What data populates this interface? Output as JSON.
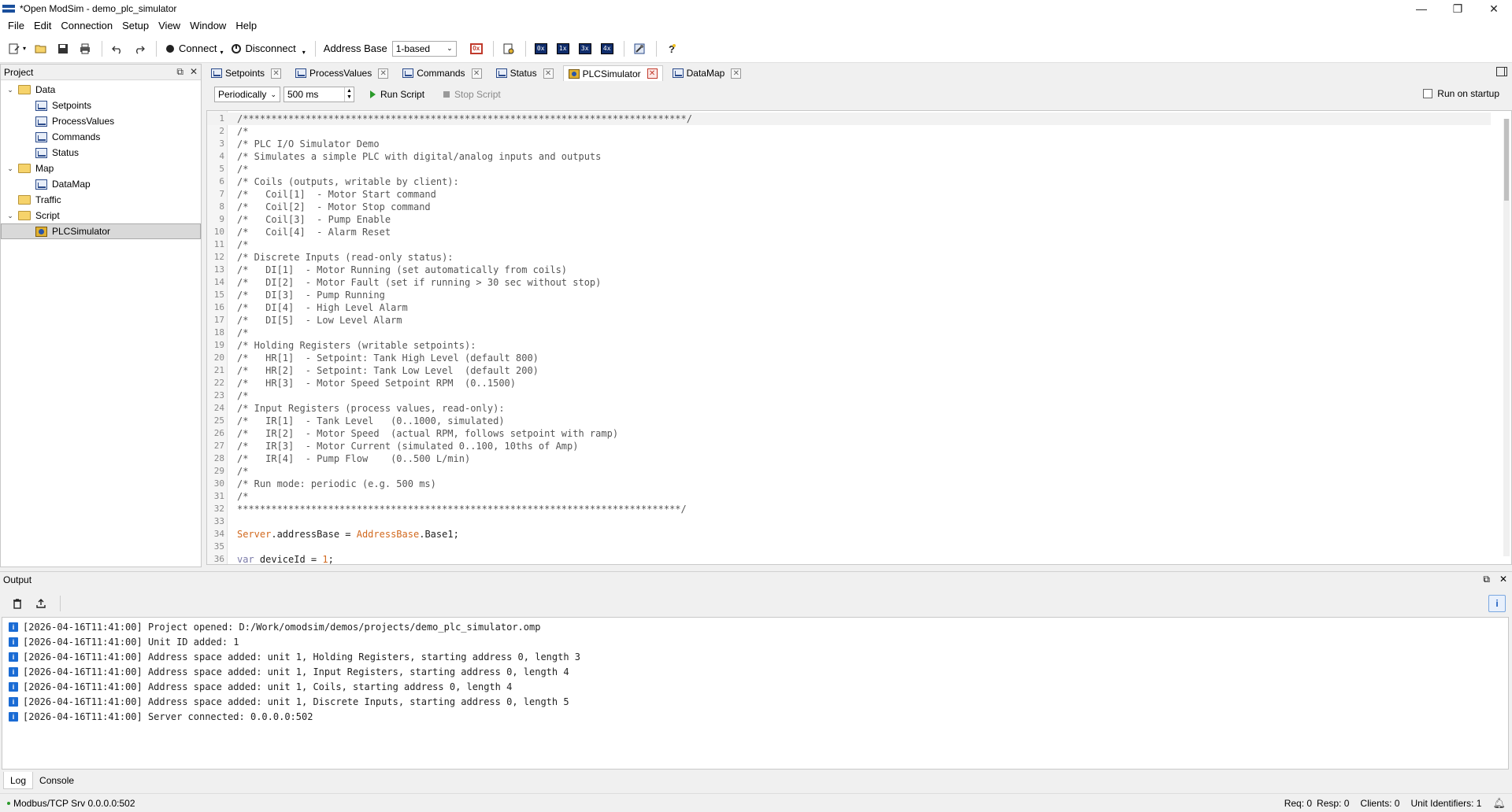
{
  "window": {
    "title": "*Open ModSim - demo_plc_simulator",
    "controls": [
      "—",
      "❐",
      "✕"
    ]
  },
  "menu": [
    "File",
    "Edit",
    "Connection",
    "Setup",
    "View",
    "Window",
    "Help"
  ],
  "toolbar": {
    "connect_label": "Connect",
    "disconnect_label": "Disconnect",
    "address_base_label": "Address Base",
    "address_base_value": "1-based",
    "reg_buttons": [
      "0x",
      "1x",
      "3x",
      "4x"
    ]
  },
  "project": {
    "title": "Project",
    "tree": [
      {
        "label": "Data",
        "type": "folder",
        "expanded": true,
        "children": [
          "Setpoints",
          "ProcessValues",
          "Commands",
          "Status"
        ]
      },
      {
        "label": "Map",
        "type": "folder",
        "expanded": true,
        "children": [
          "DataMap"
        ]
      },
      {
        "label": "Traffic",
        "type": "folder",
        "expanded": false,
        "children": []
      },
      {
        "label": "Script",
        "type": "folder",
        "expanded": true,
        "children": [
          "PLCSimulator"
        ]
      }
    ],
    "selected": "PLCSimulator"
  },
  "tabs": [
    {
      "label": "Setpoints",
      "kind": "data"
    },
    {
      "label": "ProcessValues",
      "kind": "data"
    },
    {
      "label": "Commands",
      "kind": "data"
    },
    {
      "label": "Status",
      "kind": "data"
    },
    {
      "label": "PLCSimulator",
      "kind": "script",
      "active": true
    },
    {
      "label": "DataMap",
      "kind": "data"
    }
  ],
  "script_toolbar": {
    "mode": "Periodically",
    "interval": "500 ms",
    "run_label": "Run Script",
    "stop_label": "Stop Script",
    "run_on_startup_label": "Run on startup",
    "run_on_startup_checked": false
  },
  "code_lines": [
    "/******************************************************************************/",
    "/*",
    "/* PLC I/O Simulator Demo",
    "/* Simulates a simple PLC with digital/analog inputs and outputs",
    "/*",
    "/* Coils (outputs, writable by client):",
    "/*   Coil[1]  - Motor Start command",
    "/*   Coil[2]  - Motor Stop command",
    "/*   Coil[3]  - Pump Enable",
    "/*   Coil[4]  - Alarm Reset",
    "/*",
    "/* Discrete Inputs (read-only status):",
    "/*   DI[1]  - Motor Running (set automatically from coils)",
    "/*   DI[2]  - Motor Fault (set if running > 30 sec without stop)",
    "/*   DI[3]  - Pump Running",
    "/*   DI[4]  - High Level Alarm",
    "/*   DI[5]  - Low Level Alarm",
    "/*",
    "/* Holding Registers (writable setpoints):",
    "/*   HR[1]  - Setpoint: Tank High Level (default 800)",
    "/*   HR[2]  - Setpoint: Tank Low Level  (default 200)",
    "/*   HR[3]  - Motor Speed Setpoint RPM  (0..1500)",
    "/*",
    "/* Input Registers (process values, read-only):",
    "/*   IR[1]  - Tank Level   (0..1000, simulated)",
    "/*   IR[2]  - Motor Speed  (actual RPM, follows setpoint with ramp)",
    "/*   IR[3]  - Motor Current (simulated 0..100, 10ths of Amp)",
    "/*   IR[4]  - Pump Flow    (0..500 L/min)",
    "/*",
    "/* Run mode: periodic (e.g. 500 ms)",
    "/*",
    "******************************************************************************/",
    "",
    "Server.addressBase = AddressBase.Base1;",
    "",
    "var deviceId = 1;"
  ],
  "output": {
    "title": "Output",
    "log": [
      "[2026-04-16T11:41:00] Project opened: D:/Work/omodsim/demos/projects/demo_plc_simulator.omp",
      "[2026-04-16T11:41:00] Unit ID added: 1",
      "[2026-04-16T11:41:00] Address space added: unit 1, Holding Registers, starting address 0, length 3",
      "[2026-04-16T11:41:00] Address space added: unit 1, Input Registers, starting address 0, length 4",
      "[2026-04-16T11:41:00] Address space added: unit 1, Coils, starting address 0, length 4",
      "[2026-04-16T11:41:00] Address space added: unit 1, Discrete Inputs, starting address 0, length 5",
      "[2026-04-16T11:41:00] Server connected: 0.0.0.0:502"
    ],
    "bottom_tabs": [
      "Log",
      "Console"
    ]
  },
  "status": {
    "connection": "Modbus/TCP Srv 0.0.0.0:502",
    "req": "Req: 0",
    "resp": "Resp: 0",
    "clients": "Clients: 0",
    "unit_ids": "Unit Identifiers: 1"
  },
  "colors": {
    "accent_blue": "#1a6bd4",
    "keyword_orange": "#d2691e",
    "run_green": "#2a9a2a"
  }
}
